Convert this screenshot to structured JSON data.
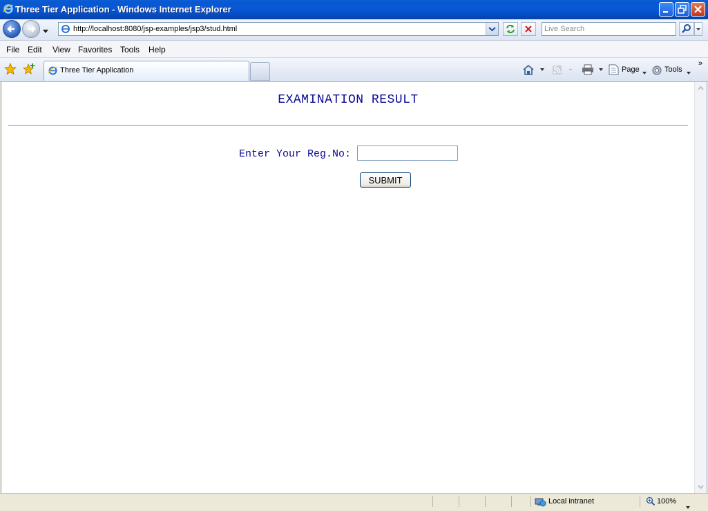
{
  "window": {
    "title": "Three Tier Application - Windows Internet Explorer",
    "title_bar_color": "#0A58CF"
  },
  "address_bar": {
    "url": "http://localhost:8080/jsp-examples/jsp3/stud.html",
    "search_placeholder": "Live Search"
  },
  "menu": {
    "items": [
      "File",
      "Edit",
      "View",
      "Favorites",
      "Tools",
      "Help"
    ]
  },
  "tabs": {
    "active_label": "Three Tier Application"
  },
  "command_bar": {
    "page_label": "Page",
    "tools_label": "Tools",
    "more_glyph": "»"
  },
  "page": {
    "heading": "EXAMINATION RESULT",
    "reg_label": "Enter Your Reg.No:",
    "reg_value": "",
    "submit_label": "SUBMIT",
    "text_color": "#0A0A96"
  },
  "status_bar": {
    "zone": "Local intranet",
    "zoom": "100%"
  }
}
